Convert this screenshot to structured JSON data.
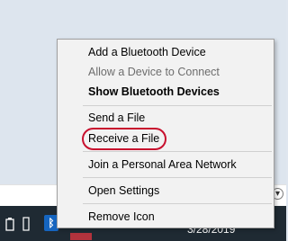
{
  "menu": {
    "items": [
      {
        "label": "Add a Bluetooth Device"
      },
      {
        "label": "Allow a Device to Connect"
      },
      {
        "label": "Show Bluetooth Devices"
      },
      {
        "label": "Send a File"
      },
      {
        "label": "Receive a File"
      },
      {
        "label": "Join a Personal Area Network"
      },
      {
        "label": "Open Settings"
      },
      {
        "label": "Remove Icon"
      }
    ]
  },
  "taskbar": {
    "date": "3/28/2019",
    "tray_icons": [
      "power-icon",
      "usb-icon",
      "bluetooth-icon",
      "app-icon"
    ]
  },
  "colors": {
    "menu_bg": "#f2f2f2",
    "taskbar_bg": "#1f2a33",
    "highlight": "#c8102e",
    "bluetooth_blue": "#1565c0"
  }
}
